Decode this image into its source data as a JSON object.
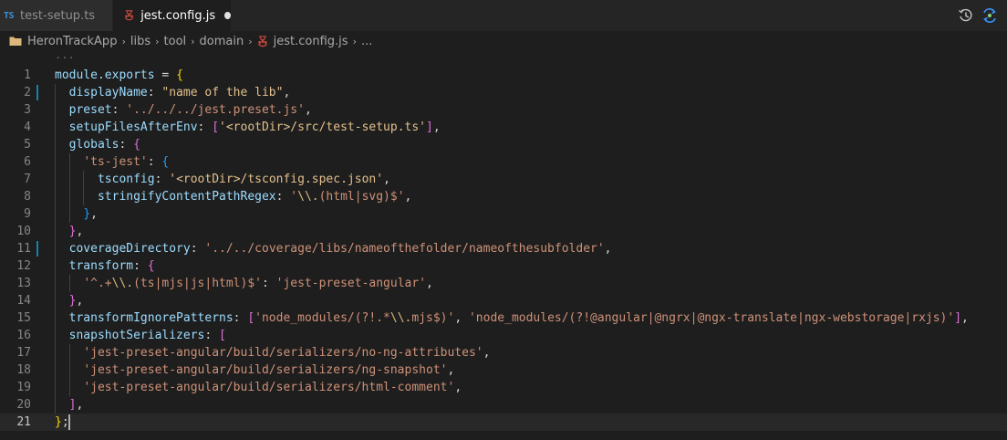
{
  "tabs": [
    {
      "label": "test-setup.ts",
      "icon": "typescript-icon",
      "icon_text": "TS",
      "active": false
    },
    {
      "label": "jest.config.js",
      "icon": "jest-icon",
      "active": true,
      "dirty": true
    }
  ],
  "tab_actions": [
    "timeline-icon",
    "compare-changes-icon"
  ],
  "breadcrumb": {
    "items": [
      "HeronTrackApp",
      "libs",
      "tool",
      "domain",
      "jest.config.js",
      "..."
    ],
    "separator": "›"
  },
  "editor": {
    "fold_hint": "...",
    "current_line": 21,
    "modified_lines": [
      2,
      11
    ],
    "lines": [
      "module.exports = {",
      "  displayName: \"name of the lib\",",
      "  preset: '../../../jest.preset.js',",
      "  setupFilesAfterEnv: ['<rootDir>/src/test-setup.ts'],",
      "  globals: {",
      "    'ts-jest': {",
      "      tsconfig: '<rootDir>/tsconfig.spec.json',",
      "      stringifyContentPathRegex: '\\\\.(html|svg)$',",
      "    },",
      "  },",
      "  coverageDirectory: '../../coverage/libs/nameofthefolder/nameofthesubfolder',",
      "  transform: {",
      "    '^.+\\\\.(ts|mjs|js|html)$': 'jest-preset-angular',",
      "  },",
      "  transformIgnorePatterns: ['node_modules/(?!.*\\\\.mjs$)', 'node_modules/(?!@angular|@ngrx|@ngx-translate|ngx-webstorage|rxjs)'],",
      "  snapshotSerializers: [",
      "    'jest-preset-angular/build/serializers/no-ng-attributes',",
      "    'jest-preset-angular/build/serializers/ng-snapshot',",
      "    'jest-preset-angular/build/serializers/html-comment',",
      "  ],",
      "};"
    ]
  },
  "colors": {
    "background": "#1e1e1e",
    "tab_bar": "#252526",
    "property": "#9cdcfe",
    "string": "#ce9178",
    "bracket_level_1": "#ffd700",
    "bracket_level_2": "#da70d6",
    "bracket_level_3": "#179fff",
    "modified_marker": "#1b81a8"
  }
}
